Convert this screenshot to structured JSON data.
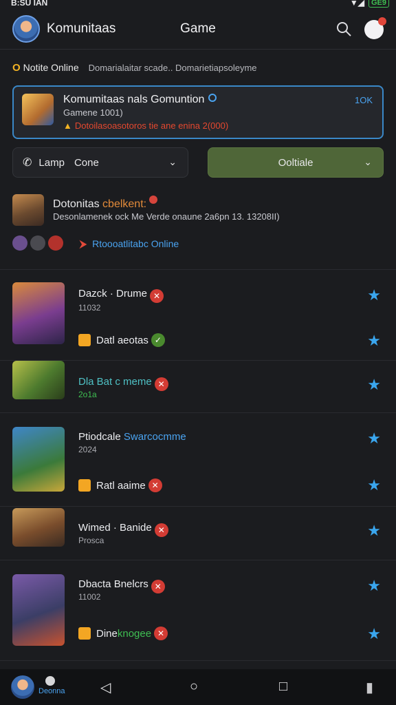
{
  "status": {
    "time": "B:SU IAN",
    "battery": "GE9"
  },
  "appbar": {
    "title": "Komunitaas",
    "center": "Game"
  },
  "notice": {
    "marker": "O",
    "strong": "Notite Online",
    "text": "Domarialaitar scade.. Domarietiapsoleyme"
  },
  "card": {
    "title": "Komumitaas nals Gomuntion",
    "subtitle": "Gamene 1001)",
    "warning": "Dotoilasoasotoros tie ane enina 2(000)",
    "right": "1OK"
  },
  "filters": {
    "left_a": "Lamp",
    "left_b": "Cone",
    "right": "Ooltiale"
  },
  "feature": {
    "title_a": "Dotonitas",
    "title_b": "cbelkent:",
    "subtitle": "Desonlamenek ock Me Verde onaune 2a6pn 13. 13208II)",
    "online": "Rtoooatlitabc Online"
  },
  "rows": [
    {
      "title": "Dazck · Drume",
      "sub": "11032",
      "tag": "Datl aeotas",
      "tag_style": "ok"
    },
    {
      "title": "Dla Bat c meme",
      "sub": "2o1a",
      "teal": true
    },
    {
      "title_a": "Ptiodcale ",
      "title_b": "Swarcocmme",
      "sub": "2024",
      "tag": "Ratl aaime",
      "tag_style": "x"
    },
    {
      "title": "Wimed · Banide",
      "sub": "Prosca"
    },
    {
      "title": "Dbacta Bnelcrs",
      "sub": "11002",
      "tag_a": "Dine ",
      "tag_b": "knogee",
      "tag_style": "x"
    }
  ],
  "navbar": {
    "user_label": "Deonna"
  }
}
